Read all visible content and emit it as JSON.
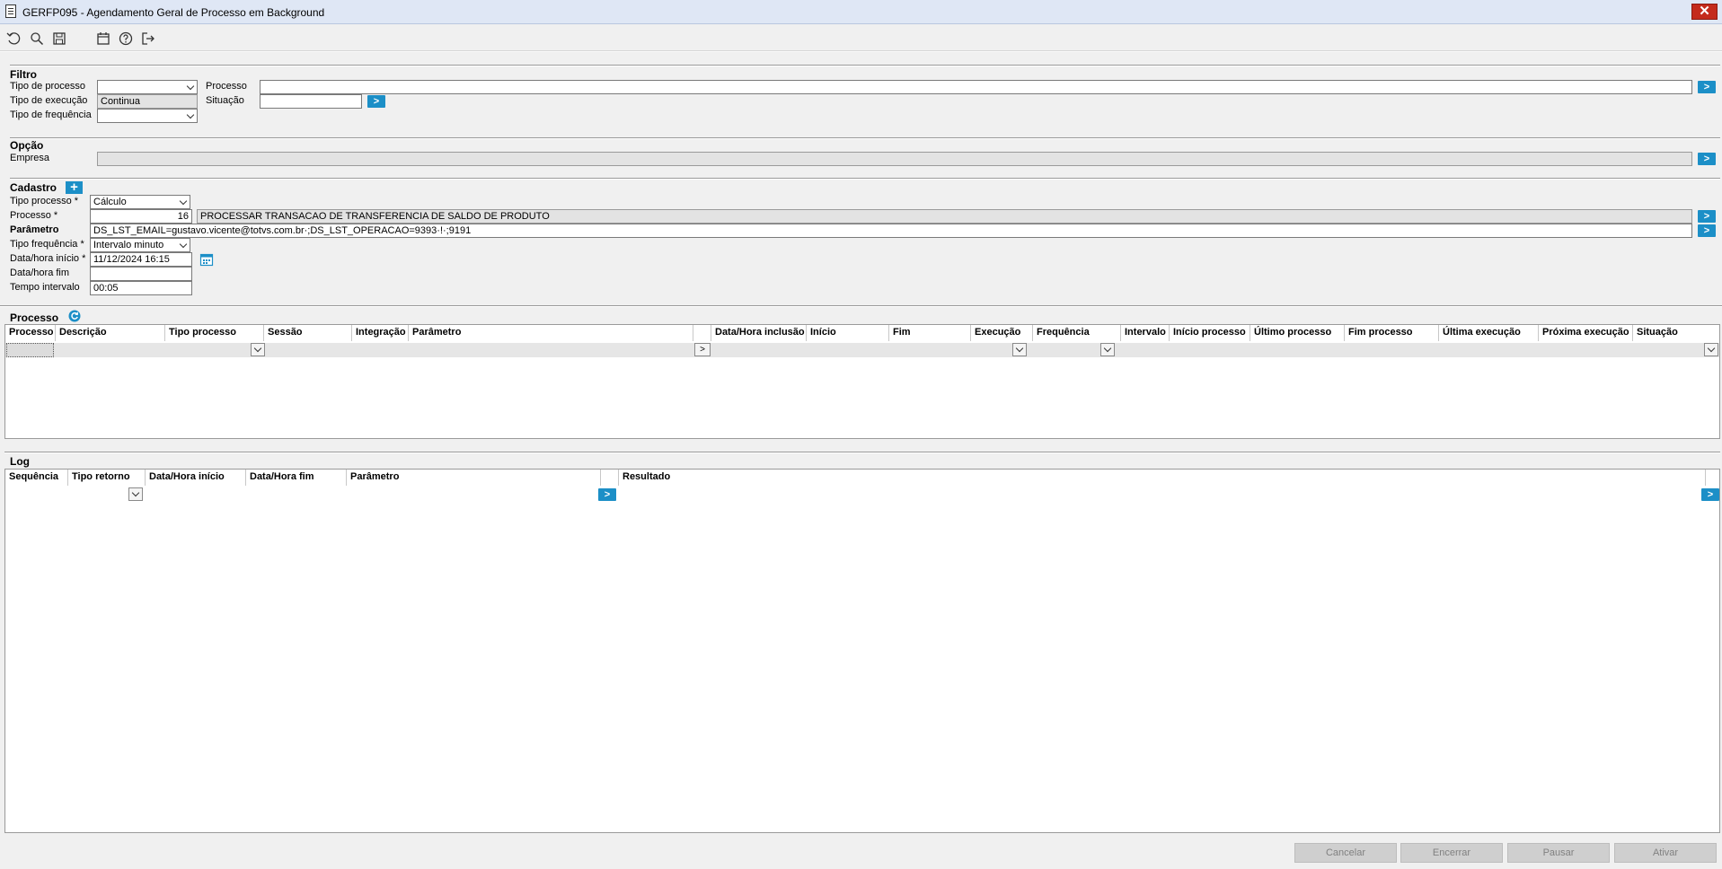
{
  "window": {
    "title": "GERFP095 - Agendamento Geral de Processo em Background",
    "close_symbol": "✕"
  },
  "toolbar": {
    "icons": [
      "undo-icon",
      "search-icon",
      "save-icon",
      "calendar-icon",
      "help-icon",
      "exit-icon"
    ]
  },
  "filtro": {
    "title": "Filtro",
    "tipo_processo_label": "Tipo de processo",
    "tipo_processo_value": "",
    "tipo_execucao_label": "Tipo de execução",
    "tipo_execucao_value": "Continua",
    "tipo_frequencia_label": "Tipo de frequência",
    "tipo_frequencia_value": "",
    "processo_label": "Processo",
    "processo_value": "",
    "situacao_label": "Situação",
    "situacao_value": "",
    "go_symbol": ">"
  },
  "opcao": {
    "title": "Opção",
    "empresa_label": "Empresa",
    "empresa_value": ""
  },
  "cadastro": {
    "title": "Cadastro",
    "add_symbol": "+",
    "tipo_processo_label": "Tipo processo *",
    "tipo_processo_value": "Cálculo",
    "processo_label": "Processo *",
    "processo_code": "16",
    "processo_desc": "PROCESSAR TRANSACAO DE  TRANSFERENCIA DE SALDO DE PRODUTO",
    "parametro_label": "Parâmetro",
    "parametro_value": "DS_LST_EMAIL=gustavo.vicente@totvs.com.br·;DS_LST_OPERACAO=9393·!·;9191",
    "tipo_frequencia_label": "Tipo frequência *",
    "tipo_frequencia_value": "Intervalo minuto",
    "data_inicio_label": "Data/hora início *",
    "data_inicio_value": "11/12/2024 16:15",
    "data_fim_label": "Data/hora fim",
    "data_fim_value": "",
    "tempo_intervalo_label": "Tempo intervalo",
    "tempo_intervalo_value": "00:05"
  },
  "processo_grid": {
    "title": "Processo",
    "columns": [
      "Processo",
      "Descrição",
      "Tipo processo",
      "Sessão",
      "Integração",
      "Parâmetro",
      "",
      "Data/Hora inclusão",
      "Início",
      "Fim",
      "Execução",
      "Frequência",
      "Intervalo",
      "Início processo",
      "Último processo",
      "Fim processo",
      "Última execução",
      "Próxima execução",
      "Situação"
    ],
    "param_btn": ">"
  },
  "log_grid": {
    "title": "Log",
    "columns": [
      "Sequência",
      "Tipo retorno",
      "Data/Hora início",
      "Data/Hora fim",
      "Parâmetro",
      "",
      "Resultado"
    ],
    "go_symbol": ">"
  },
  "buttons": {
    "cancelar": "Cancelar",
    "encerrar": "Encerrar",
    "pausar": "Pausar",
    "ativar": "Ativar"
  },
  "colors": {
    "accent": "#1c8fc7",
    "close": "#c42b1c",
    "background": "#f0f0f0"
  }
}
